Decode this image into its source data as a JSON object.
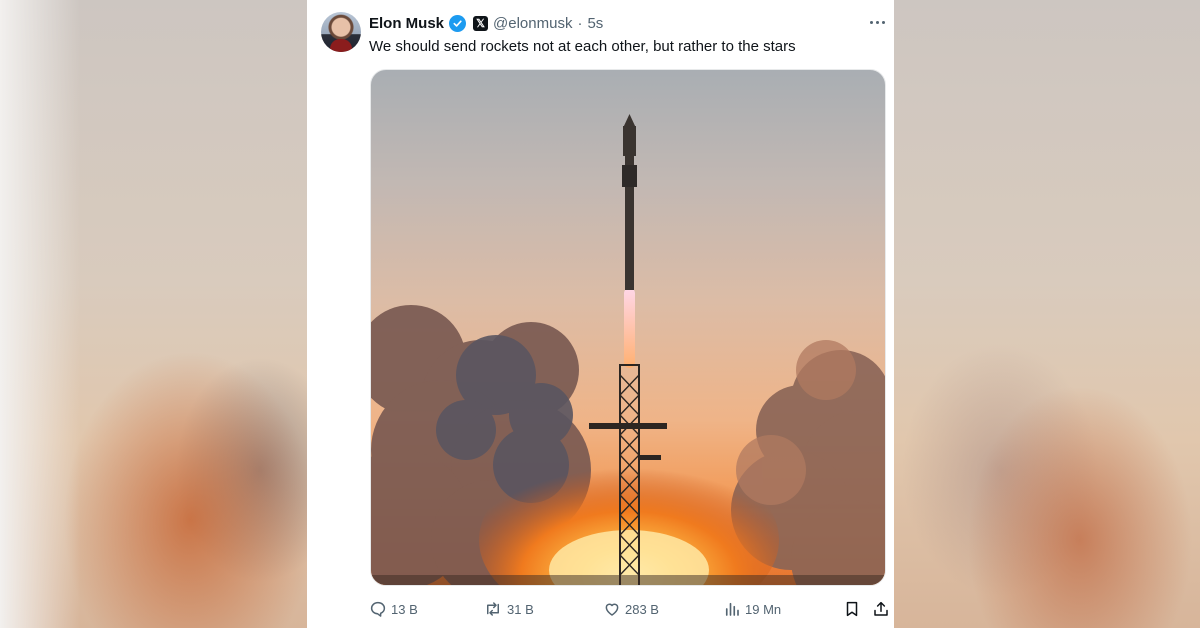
{
  "tweet": {
    "author_name": "Elon Musk",
    "handle": "@elonmusk",
    "separator": "·",
    "time": "5s",
    "x_badge": "𝕏",
    "text": "We should send rockets not at each other, but rather to the stars"
  },
  "media": {
    "alt": "Rocket launch photo"
  },
  "actions": {
    "replies": "13 B",
    "reposts": "31 B",
    "likes": "283 B",
    "views": "19 Mn"
  },
  "icons": {
    "verified": "verified-badge-icon",
    "more": "more-options-icon",
    "reply": "reply-icon",
    "repost": "repost-icon",
    "like": "like-icon",
    "views": "views-icon",
    "bookmark": "bookmark-icon",
    "share": "share-icon"
  },
  "colors": {
    "verified_blue": "#1d9bf0",
    "secondary_text": "#536471",
    "primary_text": "#0f1419"
  }
}
